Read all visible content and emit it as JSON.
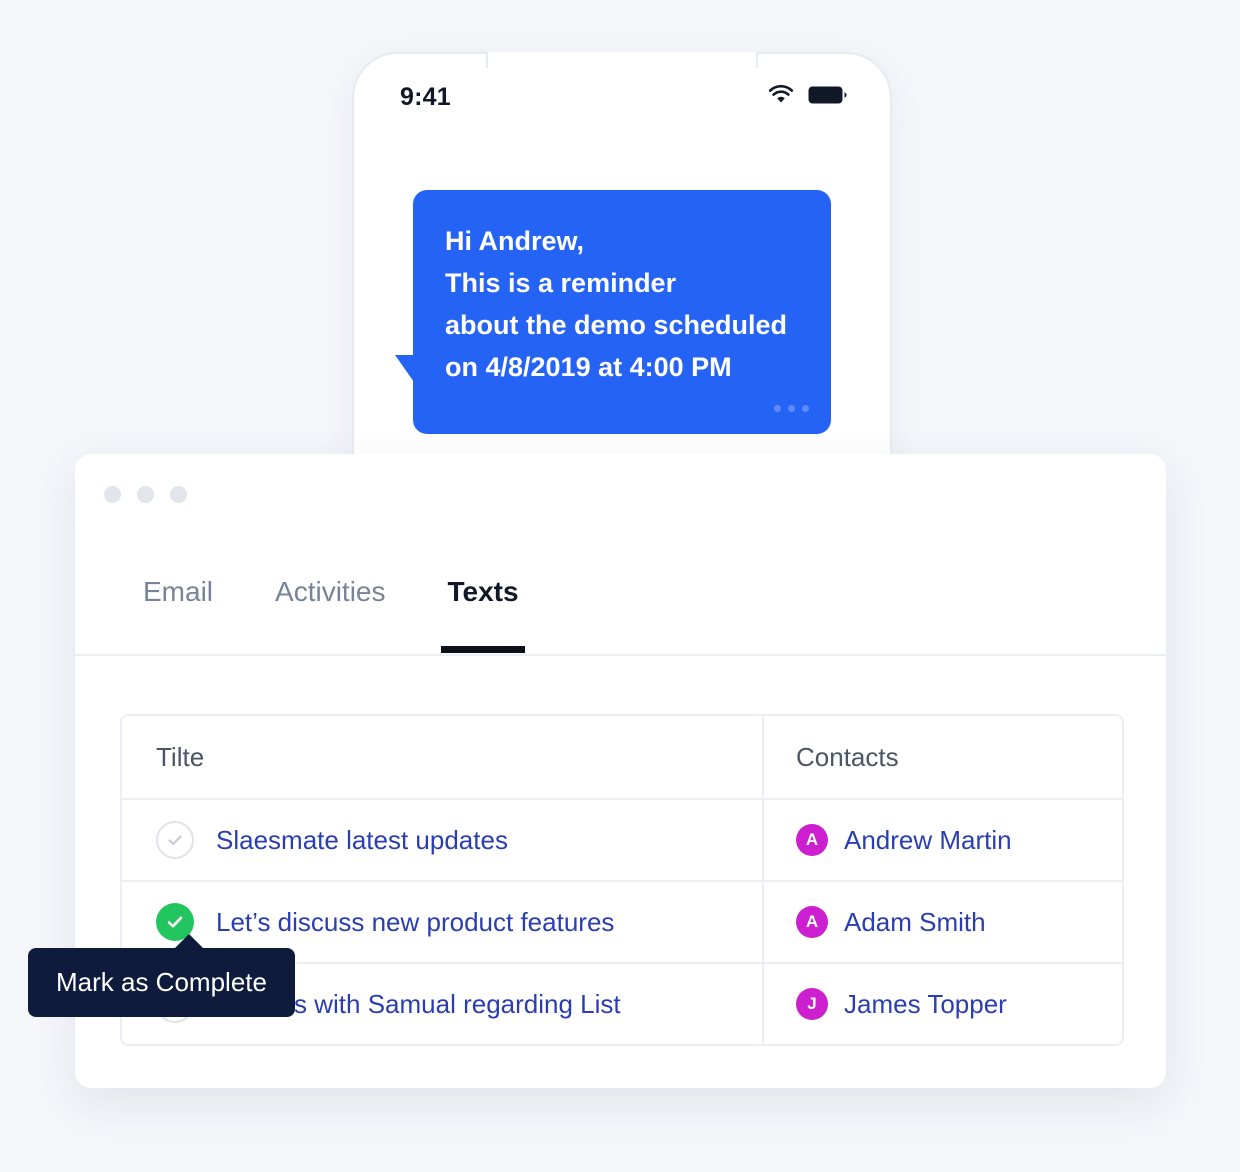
{
  "phone": {
    "status_time": "9:41",
    "wifi_icon": "wifi-icon",
    "battery_icon": "battery-full-icon",
    "message": {
      "lines": [
        "Hi Andrew,",
        "This is a reminder",
        "about the demo scheduled",
        "on 4/8/2019 at 4:00 PM"
      ],
      "bubble_color": "#2563f5",
      "typing_dots": "more-dots-icon"
    }
  },
  "card": {
    "window_controls": [
      "dot-1",
      "dot-2",
      "dot-3"
    ],
    "tabs": [
      {
        "label": "Email",
        "active": false
      },
      {
        "label": "Activities",
        "active": false
      },
      {
        "label": "Texts",
        "active": true
      }
    ],
    "table": {
      "columns": [
        "Tilte",
        "Contacts"
      ],
      "rows": [
        {
          "completed": false,
          "title": "Slaesmate latest updates",
          "contact": "Andrew Martin",
          "initial": "A"
        },
        {
          "completed": true,
          "title": "Let’s discuss new product features",
          "contact": "Adam Smith",
          "initial": "A"
        },
        {
          "completed": false,
          "title": "Discuss with Samual regarding List",
          "contact": "James Topper",
          "initial": "J"
        }
      ]
    }
  },
  "tooltip": {
    "label": "Mark as Complete",
    "background": "#0e1b3d"
  },
  "colors": {
    "page_background": "#f4f6fa",
    "accent_blue": "#2563f5",
    "link_blue": "#2a3eb1",
    "avatar_magenta": "#cc1fd0",
    "check_green": "#22c55e"
  }
}
